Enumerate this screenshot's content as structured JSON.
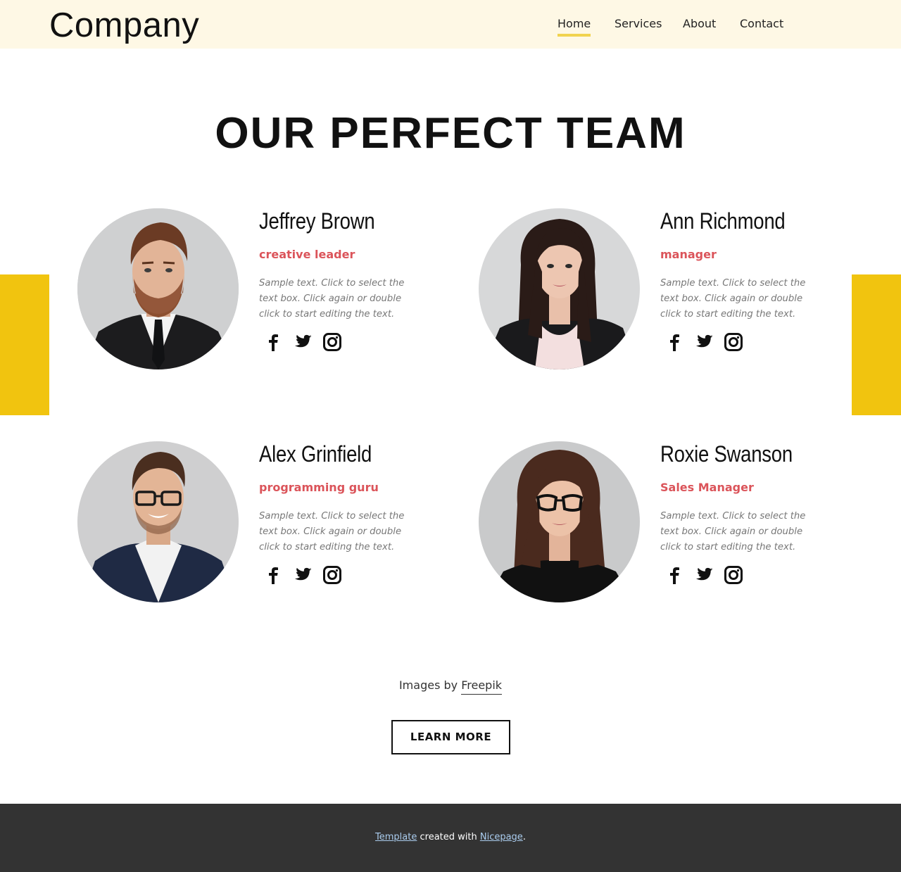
{
  "header": {
    "logo": "Company",
    "nav": [
      {
        "label": "Home",
        "active": true
      },
      {
        "label": "Services",
        "active": false
      },
      {
        "label": "About",
        "active": false
      },
      {
        "label": "Contact",
        "active": false
      }
    ]
  },
  "section": {
    "title": "OUR PERFECT TEAM"
  },
  "team": [
    {
      "name": "Jeffrey Brown",
      "role": "creative leader",
      "description": "Sample text. Click to select the text box. Click again or double click to start editing the text."
    },
    {
      "name": "Ann Richmond",
      "role": "manager",
      "description": "Sample text. Click to select the text box. Click again or double click to start editing the text."
    },
    {
      "name": "Alex Grinfield",
      "role": "programming guru",
      "description": "Sample text. Click to select the text box. Click again or double click to start editing the text."
    },
    {
      "name": "Roxie Swanson",
      "role": "Sales Manager",
      "description": "Sample text. Click to select the text box. Click again or double click to start editing the text."
    }
  ],
  "socials": [
    "facebook-icon",
    "twitter-icon",
    "instagram-icon"
  ],
  "credit": {
    "prefix": "Images by",
    "link": "Freepik"
  },
  "cta": {
    "label": "LEARN MORE"
  },
  "footer": {
    "link1": "Template",
    "middle": " created with ",
    "link2": "Nicepage",
    "suffix": "."
  },
  "colors": {
    "header_bg": "#fef8e5",
    "accent_yellow": "#f1c40f",
    "nav_underline": "#f1d34f",
    "role_red": "#db545a",
    "footer_bg": "#333333"
  }
}
